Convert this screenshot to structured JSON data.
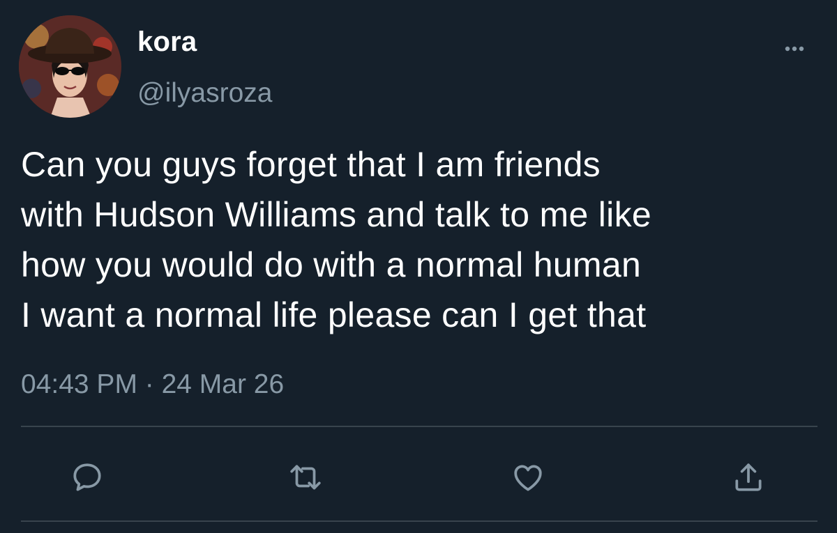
{
  "author": {
    "display_name": "kora",
    "handle": "@ilyasroza"
  },
  "tweet": {
    "text": "Can you guys forget that I am friends\nwith Hudson Williams and talk to me like\nhow you would do with a normal human\nI want a normal life please can I get that",
    "timestamp": "04:43 PM · 24 Mar 26"
  },
  "icons": {
    "more": "more-horizontal-icon",
    "reply": "reply-icon",
    "retweet": "retweet-icon",
    "like": "heart-icon",
    "share": "share-icon"
  },
  "colors": {
    "background": "#15202b",
    "text": "#ffffff",
    "secondary_text": "#8899a6",
    "divider": "#38444d"
  }
}
